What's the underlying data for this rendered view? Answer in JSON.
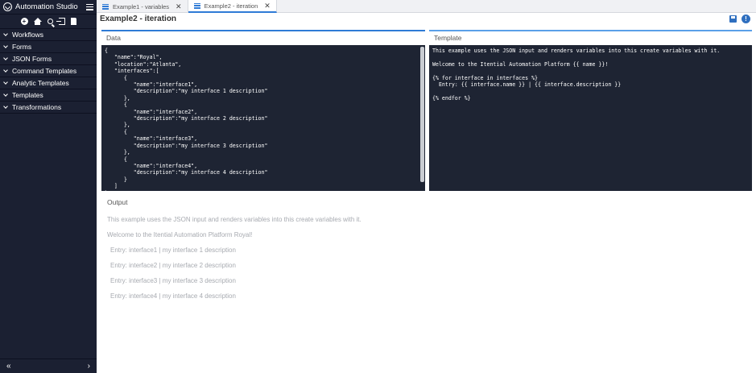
{
  "app": {
    "title": "Automation Studio"
  },
  "sidebar": {
    "items": [
      {
        "label": "Workflows"
      },
      {
        "label": "Forms"
      },
      {
        "label": "JSON Forms"
      },
      {
        "label": "Command Templates"
      },
      {
        "label": "Analytic Templates"
      },
      {
        "label": "Templates"
      },
      {
        "label": "Transformations"
      }
    ],
    "footer": {
      "collapse": "«",
      "expand": "›"
    }
  },
  "tabs": [
    {
      "label": "Example1 - variables",
      "close": "✕",
      "active": false
    },
    {
      "label": "Example2 - iteration",
      "close": "✕",
      "active": true
    }
  ],
  "page": {
    "title": "Example2 - iteration",
    "info": "!"
  },
  "data_panel": {
    "label": "Data",
    "code": "{\n   \"name\":\"Royal\",\n   \"location\":\"Atlanta\",\n   \"interfaces\":[\n      {\n         \"name\":\"interface1\",\n         \"description\":\"my interface 1 description\"\n      },\n      {\n         \"name\":\"interface2\",\n         \"description\":\"my interface 2 description\"\n      },\n      {\n         \"name\":\"interface3\",\n         \"description\":\"my interface 3 description\"\n      },\n      {\n         \"name\":\"interface4\",\n         \"description\":\"my interface 4 description\"\n      }\n   ]\n}"
  },
  "template_panel": {
    "label": "Template",
    "code": "This example uses the JSON input and renders variables into this create variables with it.\n\nWelcome to the Itential Automation Platform {{ name }}!\n\n{% for interface in interfaces %}\n  Entry: {{ interface.name }} | {{ interface.description }}\n\n{% endfor %}"
  },
  "output": {
    "label": "Output",
    "intro": "This example uses the JSON input and renders variables into this create variables with it.",
    "welcome": "Welcome to the Itential Automation Platform Royal!",
    "entries": [
      "Entry: interface1 | my interface 1 description",
      "Entry: interface2 | my interface 2 description",
      "Entry: interface3 | my interface 3 description",
      "Entry: interface4 | my interface 4 description"
    ]
  },
  "colors": {
    "sidebar_bg": "#1b2032",
    "accent": "#2f7bd6",
    "code_bg": "#1e2433"
  }
}
